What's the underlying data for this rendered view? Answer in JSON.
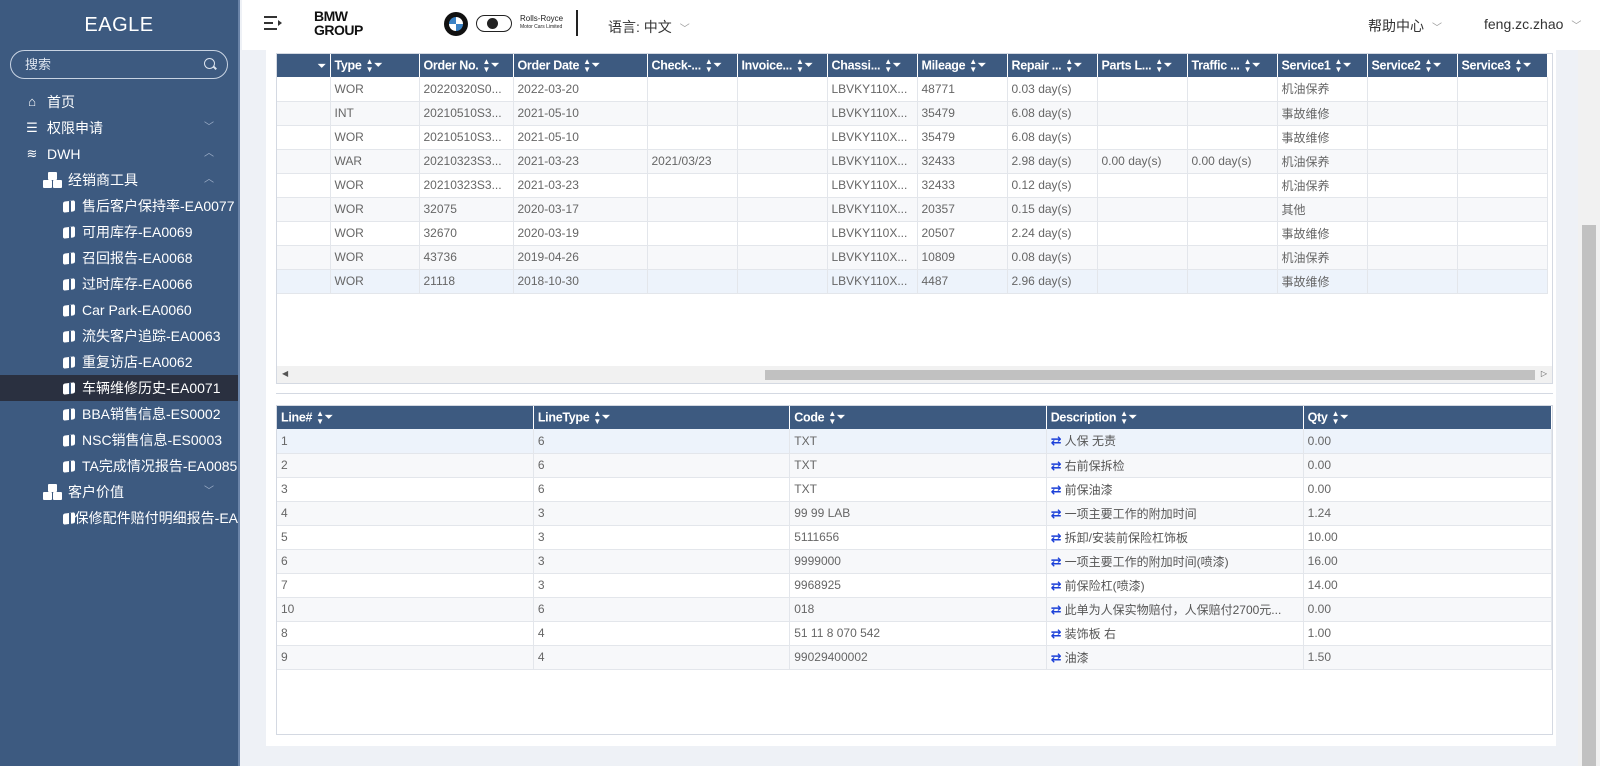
{
  "app": {
    "logo": "EAGLE",
    "search_placeholder": "搜索"
  },
  "sidebar": {
    "items": [
      {
        "label": "首页",
        "icon": "home-icon",
        "level": 0
      },
      {
        "label": "权限申请",
        "icon": "list-icon",
        "level": 0,
        "chevron": "down"
      },
      {
        "label": "DWH",
        "icon": "database-icon",
        "level": 0,
        "chevron": "up"
      },
      {
        "label": "经销商工具",
        "icon": "cubes-icon",
        "level": 1,
        "chevron": "up"
      },
      {
        "label": "售后客户保持率-EA0077",
        "icon": "cube-icon",
        "level": 2
      },
      {
        "label": "可用库存-EA0069",
        "icon": "cube-icon",
        "level": 2
      },
      {
        "label": "召回报告-EA0068",
        "icon": "cube-icon",
        "level": 2
      },
      {
        "label": "过时库存-EA0066",
        "icon": "cube-icon",
        "level": 2
      },
      {
        "label": "Car Park-EA0060",
        "icon": "cube-icon",
        "level": 2
      },
      {
        "label": "流失客户追踪-EA0063",
        "icon": "cube-icon",
        "level": 2
      },
      {
        "label": "重复访店-EA0062",
        "icon": "cube-icon",
        "level": 2
      },
      {
        "label": "车辆维修历史-EA0071",
        "icon": "cube-icon",
        "level": 2,
        "active": true
      },
      {
        "label": "BBA销售信息-ES0002",
        "icon": "cube-icon",
        "level": 2
      },
      {
        "label": "NSC销售信息-ES0003",
        "icon": "cube-icon",
        "level": 2
      },
      {
        "label": "TA完成情况报告-EA0085",
        "icon": "cube-icon",
        "level": 2
      },
      {
        "label": "客户价值",
        "icon": "cubes-icon",
        "level": 1,
        "chevron": "down"
      },
      {
        "label": "保修配件赔付明细报告-EA",
        "icon": "cube-icon",
        "level": 2
      }
    ]
  },
  "header": {
    "brand_line1": "BMW",
    "brand_line2": "GROUP",
    "rr_line1": "Rolls-Royce",
    "rr_line2": "Motor Cars Limited",
    "language": "语言: 中文",
    "help": "帮助中心",
    "user": "feng.zc.zhao"
  },
  "orders": {
    "columns": [
      "",
      "Type",
      "Order No.",
      "Order Date",
      "Check-...",
      "Invoice...",
      "Chassi...",
      "Mileage",
      "Repair ...",
      "Parts L...",
      "Traffic ...",
      "Service1",
      "Service2",
      "Service3"
    ],
    "rows": [
      [
        "",
        "WOR",
        "20220320S0...",
        "2022-03-20",
        "",
        "",
        "LBVKY110X...",
        "48771",
        "0.03 day(s)",
        "",
        "",
        "机油保养",
        "",
        ""
      ],
      [
        "",
        "INT",
        "20210510S3...",
        "2021-05-10",
        "",
        "",
        "LBVKY110X...",
        "35479",
        "6.08 day(s)",
        "",
        "",
        "事故维修",
        "",
        ""
      ],
      [
        "",
        "WOR",
        "20210510S3...",
        "2021-05-10",
        "",
        "",
        "LBVKY110X...",
        "35479",
        "6.08 day(s)",
        "",
        "",
        "事故维修",
        "",
        ""
      ],
      [
        "",
        "WAR",
        "20210323S3...",
        "2021-03-23",
        "2021/03/23",
        "",
        "LBVKY110X...",
        "32433",
        "2.98 day(s)",
        "0.00 day(s)",
        "0.00 day(s)",
        "机油保养",
        "",
        ""
      ],
      [
        "",
        "WOR",
        "20210323S3...",
        "2021-03-23",
        "",
        "",
        "LBVKY110X...",
        "32433",
        "0.12 day(s)",
        "",
        "",
        "机油保养",
        "",
        ""
      ],
      [
        "",
        "WOR",
        "32075",
        "2020-03-17",
        "",
        "",
        "LBVKY110X...",
        "20357",
        "0.15 day(s)",
        "",
        "",
        "其他",
        "",
        ""
      ],
      [
        "",
        "WOR",
        "32670",
        "2020-03-19",
        "",
        "",
        "LBVKY110X...",
        "20507",
        "2.24 day(s)",
        "",
        "",
        "事故维修",
        "",
        ""
      ],
      [
        "",
        "WOR",
        "43736",
        "2019-04-26",
        "",
        "",
        "LBVKY110X...",
        "10809",
        "0.08 day(s)",
        "",
        "",
        "机油保养",
        "",
        ""
      ],
      [
        "",
        "WOR",
        "21118",
        "2018-10-30",
        "",
        "",
        "LBVKY110X...",
        "4487",
        "2.96 day(s)",
        "",
        "",
        "事故维修",
        "",
        ""
      ]
    ],
    "selected_row": 8
  },
  "lines": {
    "columns": [
      "Line#",
      "LineType",
      "Code",
      "Description",
      "Qty"
    ],
    "rows": [
      [
        "1",
        "6",
        "TXT",
        "人保 无责",
        "0.00"
      ],
      [
        "2",
        "6",
        "TXT",
        "右前保拆检",
        "0.00"
      ],
      [
        "3",
        "6",
        "TXT",
        "前保油漆",
        "0.00"
      ],
      [
        "4",
        "3",
        "99 99 LAB",
        "一项主要工作的附加时间",
        "1.24"
      ],
      [
        "5",
        "3",
        "5111656",
        "拆卸/安装前保险杠饰板",
        "10.00"
      ],
      [
        "6",
        "3",
        "9999000",
        "一项主要工作的附加时间(喷漆)",
        "16.00"
      ],
      [
        "7",
        "3",
        "9968925",
        "前保险杠(喷漆)",
        "14.00"
      ],
      [
        "10",
        "6",
        "018",
        "此单为人保实物赔付，人保赔付2700元...",
        "0.00"
      ],
      [
        "8",
        "4",
        "51 11 8 070 542",
        "装饰板 右",
        "1.00"
      ],
      [
        "9",
        "4",
        "99029400002",
        "油漆",
        "1.50"
      ]
    ],
    "selected_row": 0
  }
}
